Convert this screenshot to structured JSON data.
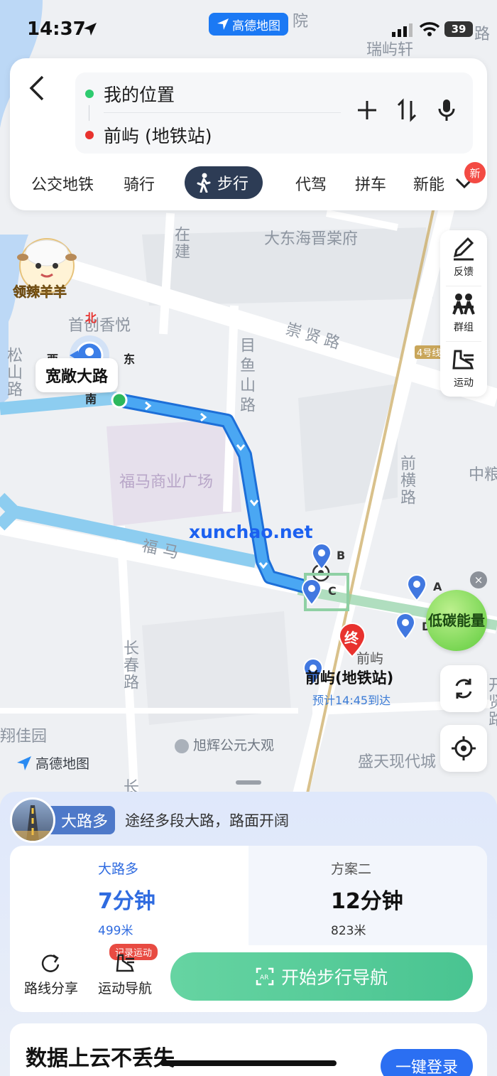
{
  "status_bar": {
    "time": "14:37",
    "app_badge": "高德地图",
    "battery": "39"
  },
  "route": {
    "origin": "我的位置",
    "destination": "前屿 (地铁站)",
    "origin_color": "#2ecb6f",
    "destination_color": "#e8322e"
  },
  "modes": {
    "items": [
      "公交地铁",
      "骑行",
      "步行",
      "代驾",
      "拼车",
      "新能"
    ],
    "active": "步行",
    "new_badge": "新"
  },
  "promo": {
    "sheep_label": "领辣羊羊"
  },
  "tools": {
    "feedback": "反馈",
    "group": "群组",
    "sport": "运动"
  },
  "map": {
    "labels": {
      "top_place1": "瑞屿轩",
      "top_place2": "院",
      "top_right": "路",
      "dongfu": "大东海晋棠府",
      "chongxian": "崇贤路",
      "zaijian": "在建",
      "muyushan": "目鱼山路",
      "shouqi": "首创香悦",
      "songshan": "松山路",
      "fuma_plaza": "福马商业广场",
      "qianheng": "前横路",
      "zhongliang": "中粮",
      "fuma_road": "福马",
      "changchun": "长春路",
      "xiangjia": "翔佳园",
      "xuhui": "旭辉公元大观",
      "shengtian": "盛天现代城",
      "kaixian": "开贤路",
      "chang": "长",
      "qianyu_small": "前屿",
      "metro4": "4号线"
    },
    "compass": {
      "north": "北",
      "south": "南",
      "west": "西",
      "east": "东"
    },
    "current_road": "宽敞大路",
    "waypoints": [
      "A",
      "B",
      "C",
      "D"
    ],
    "end_marker": "终",
    "destination_title": "前屿(地铁站)",
    "eta": "预计14:45到达",
    "watermark": "xunchao.net",
    "low_carbon": "低碳能量",
    "close": "×",
    "logo": "高德地图",
    "route_color": "#3a8fe8"
  },
  "sheet": {
    "tag": "大路多",
    "tag_desc": "途经多段大路，路面开阔",
    "plans": [
      {
        "name": "大路多",
        "duration": "7分钟",
        "distance": "499米"
      },
      {
        "name": "方案二",
        "duration": "12分钟",
        "distance": "823米"
      }
    ],
    "actions": {
      "share": "路线分享",
      "sport_nav": "运动导航",
      "record_badge": "记录运动"
    },
    "start_button": "开始步行导航",
    "cloud_title": "数据上云不丢失",
    "login_button": "一键登录"
  }
}
